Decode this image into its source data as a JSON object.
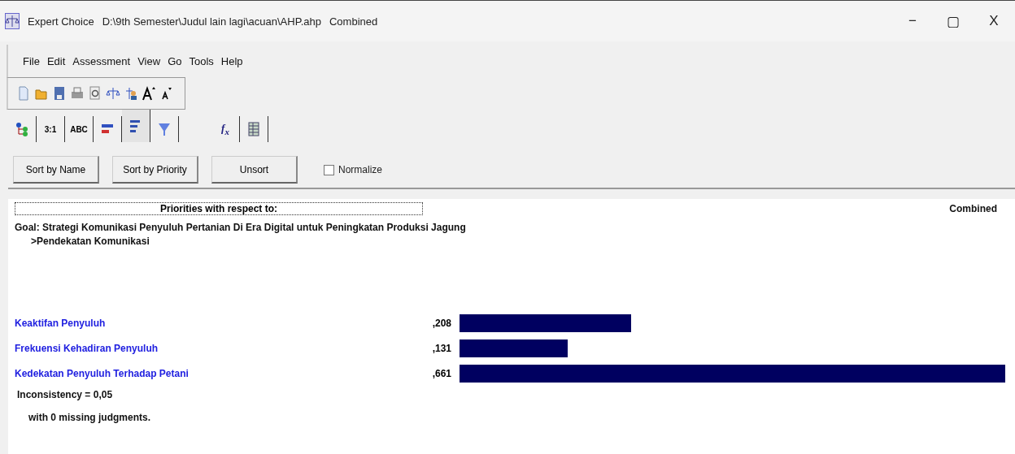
{
  "window": {
    "title": "Expert Choice",
    "path": "D:\\9th Semester\\Judul lain lagi\\acuan\\AHP.ahp",
    "mode": "Combined",
    "controls": [
      "−",
      "▢",
      "X"
    ]
  },
  "menu": [
    "File",
    "Edit",
    "Assessment",
    "View",
    "Go",
    "Tools",
    "Help"
  ],
  "tabs": [
    {
      "kind": "tree",
      "selected": false
    },
    {
      "kind": "text",
      "label": "3:1",
      "selected": false
    },
    {
      "kind": "text",
      "label": "ABC",
      "selected": false
    },
    {
      "kind": "redbars",
      "selected": false
    },
    {
      "kind": "bluebars",
      "selected": true
    },
    {
      "kind": "funnel",
      "selected": false
    },
    {
      "kind": "fx",
      "label": "f$_{x}$",
      "selected": false
    },
    {
      "kind": "grid",
      "selected": false
    }
  ],
  "buttons": [
    "Sort by Name",
    "Sort by Priority",
    "Unsort"
  ],
  "normalize": {
    "label": "Normalize",
    "checked": false
  },
  "header": {
    "title": "Priorities with respect to:",
    "right": "Combined"
  },
  "goal": "Goal: Strategi Komunikasi Penyuluh Pertanian Di Era Digital untuk Peningkatan Produksi Jagung",
  "node": ">Pendekatan Komunikasi",
  "priorities": [
    {
      "name": "Keaktifan Penyuluh",
      "value": ",208"
    },
    {
      "name": "Frekuensi Kehadiran Penyuluh",
      "value": ",131"
    },
    {
      "name": "Kedekatan Penyuluh Terhadap Petani",
      "value": ",661"
    }
  ],
  "inconsistency": "Inconsistency = 0,05",
  "missing": "with 0  missing judgments."
}
